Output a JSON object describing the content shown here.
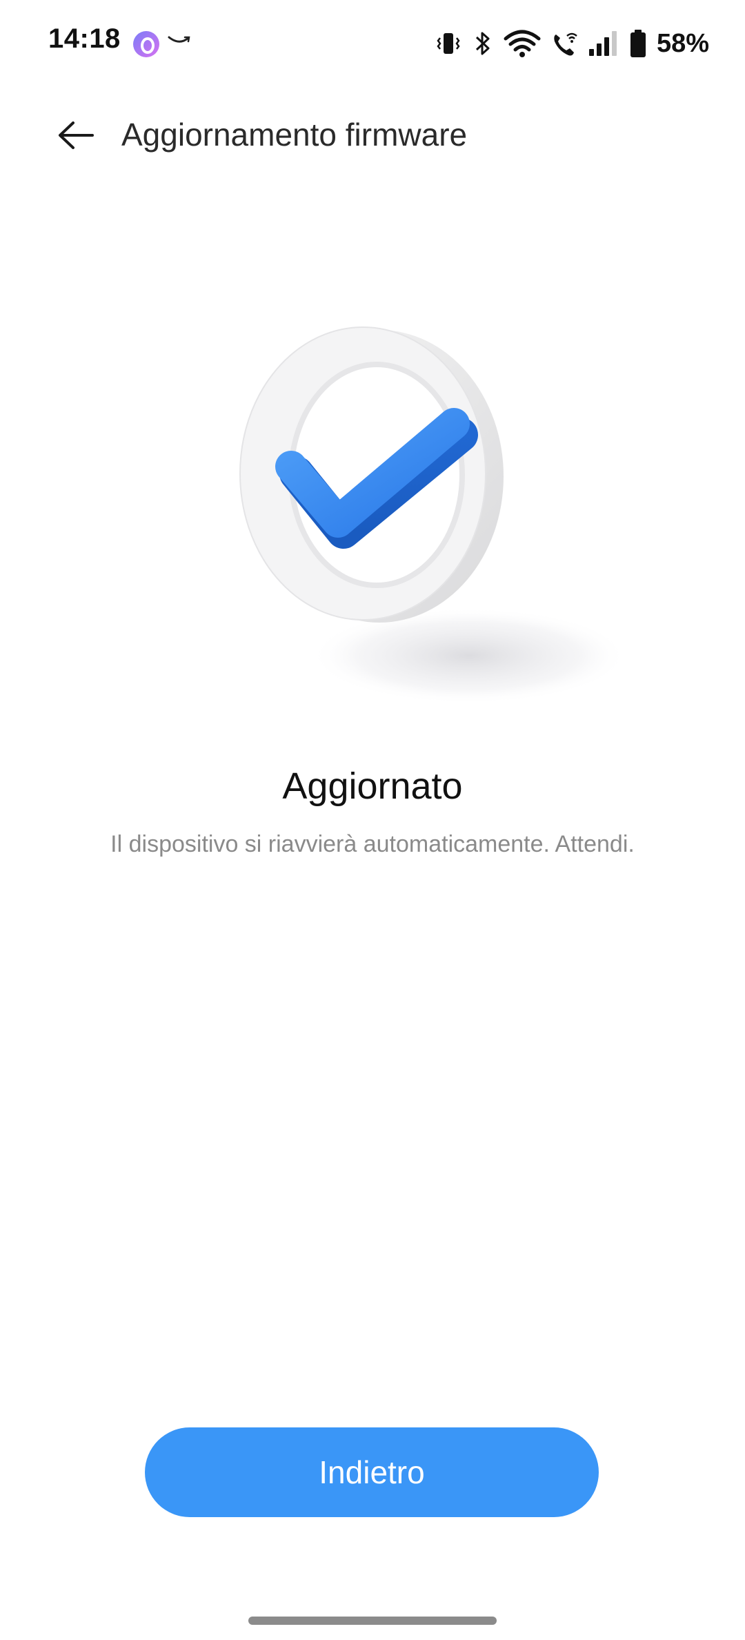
{
  "status_bar": {
    "time": "14:18",
    "battery_percent": "58%",
    "icons": [
      "app-notification-icon",
      "amazon-smile-icon",
      "vibrate-icon",
      "bluetooth-icon",
      "wifi-icon",
      "wifi-call-icon",
      "signal-icon",
      "battery-icon"
    ]
  },
  "header": {
    "back_icon": "arrow-left-icon",
    "title": "Aggiornamento firmware"
  },
  "main": {
    "illustration": "check-ring-icon",
    "heading": "Aggiornato",
    "message": "Il dispositivo si riavvierà automaticamente. Attendi.",
    "button_label": "Indietro"
  },
  "colors": {
    "accent": "#3a96f7",
    "check": "#2f80ed",
    "text_primary": "#111111",
    "text_secondary": "#8a8a8a"
  }
}
